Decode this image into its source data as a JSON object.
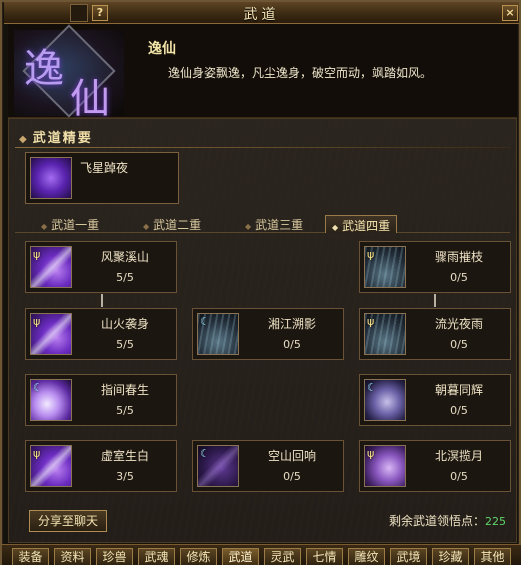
{
  "window": {
    "title": "武道",
    "help_label": "?",
    "close_label": "×"
  },
  "set": {
    "name": "逸仙",
    "emblem_chars": [
      "逸",
      "仙"
    ],
    "description": "逸仙身姿飘逸，凡尘逸身，破空而动，飒踏如风。"
  },
  "essence": {
    "section_title": "武道精要",
    "skill": {
      "name": "飞星踔夜",
      "icon": "ninja-silhouette-icon"
    }
  },
  "tiers": {
    "tabs": [
      {
        "label": "武道一重",
        "active": false
      },
      {
        "label": "武道二重",
        "active": false
      },
      {
        "label": "武道三重",
        "active": false
      },
      {
        "label": "武道四重",
        "active": true
      }
    ]
  },
  "skills": [
    {
      "name": "风聚溪山",
      "level": "5/5",
      "icon": "purple-blade-icon"
    },
    {
      "name": "骤雨摧枝",
      "level": "0/5",
      "icon": "teal-rain-icon"
    },
    {
      "name": "山火袭身",
      "level": "5/5",
      "icon": "purple-blade-icon"
    },
    {
      "name": "湘江溯影",
      "level": "0/5",
      "icon": "teal-rain-icon"
    },
    {
      "name": "流光夜雨",
      "level": "0/5",
      "icon": "teal-rain-icon"
    },
    {
      "name": "指间春生",
      "level": "5/5",
      "icon": "white-glow-icon"
    },
    {
      "name": "朝暮同辉",
      "level": "0/5",
      "icon": "moon-figure-icon"
    },
    {
      "name": "虚室生白",
      "level": "3/5",
      "icon": "purple-blade-icon"
    },
    {
      "name": "空山回响",
      "level": "0/5",
      "icon": "dark-purple-blade-icon"
    },
    {
      "name": "北溟揽月",
      "level": "0/5",
      "icon": "violet-swirl-icon"
    }
  ],
  "footer": {
    "share_label": "分享至聊天",
    "points_label": "剩余武道领悟点：",
    "points_value": "225"
  },
  "bottom_tabs": [
    {
      "label": "装备",
      "active": false
    },
    {
      "label": "资料",
      "active": false
    },
    {
      "label": "珍兽",
      "active": false
    },
    {
      "label": "武魂",
      "active": false
    },
    {
      "label": "修炼",
      "active": false
    },
    {
      "label": "武道",
      "active": true
    },
    {
      "label": "灵武",
      "active": false
    },
    {
      "label": "七情",
      "active": false
    },
    {
      "label": "雕纹",
      "active": false
    },
    {
      "label": "武境",
      "active": false
    },
    {
      "label": "珍藏",
      "active": false
    },
    {
      "label": "其他",
      "active": false
    }
  ],
  "colors": {
    "accent_gold": "#f2e4a8",
    "points_green": "#5ed66a",
    "frame": "#6d5634"
  }
}
